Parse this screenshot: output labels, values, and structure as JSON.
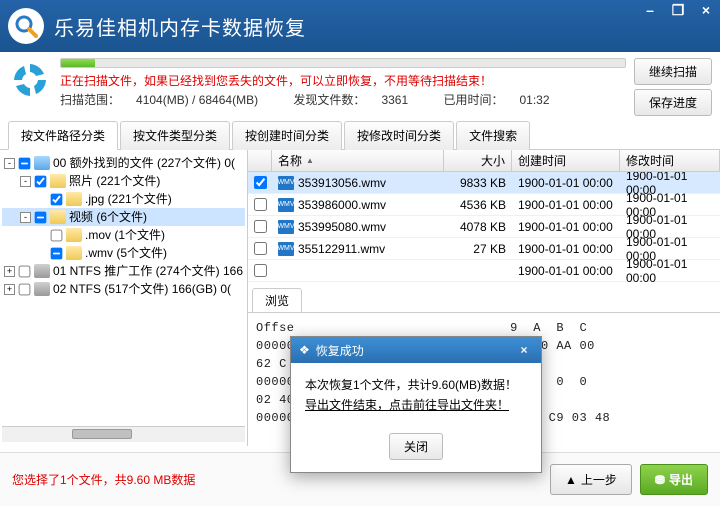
{
  "title": "乐易佳相机内存卡数据恢复",
  "window": {
    "min": "–",
    "max": "❐",
    "close": "×"
  },
  "status": {
    "message": "正在扫描文件，如果已经找到您丢失的文件，可以立即恢复，不用等待扫描结束！",
    "rangeLabel": "扫描范围：",
    "rangeValue": "4104(MB) / 68464(MB)",
    "foundLabel": "发现文件数：",
    "foundValue": "3361",
    "elapsedLabel": "已用时间：",
    "elapsedValue": "01:32",
    "btnContinue": "继续扫描",
    "btnSave": "保存进度"
  },
  "tabs": [
    "按文件路径分类",
    "按文件类型分类",
    "按创建时间分类",
    "按修改时间分类",
    "文件搜索"
  ],
  "tree": [
    {
      "depth": 0,
      "glyph": "-",
      "check": "mixed",
      "icon": "root",
      "label": "00 额外找到的文件  (227个文件) 0("
    },
    {
      "depth": 1,
      "glyph": "-",
      "check": true,
      "icon": "folder",
      "label": "照片  (221个文件)"
    },
    {
      "depth": 2,
      "glyph": "",
      "check": true,
      "icon": "folder",
      "label": ".jpg   (221个文件)"
    },
    {
      "depth": 1,
      "glyph": "-",
      "check": "mixed",
      "icon": "folder",
      "label": "视频  (6个文件)",
      "sel": true
    },
    {
      "depth": 2,
      "glyph": "",
      "check": false,
      "icon": "folder",
      "label": ".mov   (1个文件)"
    },
    {
      "depth": 2,
      "glyph": "",
      "check": "mixed",
      "icon": "folder",
      "label": ".wmv   (5个文件)"
    },
    {
      "depth": 0,
      "glyph": "+",
      "check": false,
      "icon": "drive",
      "label": "01 NTFS  推广工作  (274个文件) 166"
    },
    {
      "depth": 0,
      "glyph": "+",
      "check": false,
      "icon": "drive",
      "label": "02 NTFS     (517个文件) 166(GB) 0("
    }
  ],
  "gridHeaders": {
    "name": "名称",
    "size": "大小",
    "ctime": "创建时间",
    "mtime": "修改时间"
  },
  "gridRows": [
    {
      "check": true,
      "name": "353913056.wmv",
      "size": "9833 KB",
      "ctime": "1900-01-01  00:00",
      "mtime": "1900-01-01  00:00",
      "sel": true
    },
    {
      "check": false,
      "name": "353986000.wmv",
      "size": "4536 KB",
      "ctime": "1900-01-01  00:00",
      "mtime": "1900-01-01  00:00"
    },
    {
      "check": false,
      "name": "353995080.wmv",
      "size": "4078 KB",
      "ctime": "1900-01-01  00:00",
      "mtime": "1900-01-01  00:00"
    },
    {
      "check": false,
      "name": "355122911.wmv",
      "size": "27 KB",
      "ctime": "1900-01-01  00:00",
      "mtime": "1900-01-01  00:00"
    },
    {
      "check": false,
      "name": "",
      "size": "",
      "ctime": "1900-01-01  00:00",
      "mtime": "1900-01-01  00:00"
    }
  ],
  "previewTab": "浏览",
  "hex": "Offse                            9  A  B  C\n00000                            D9 00 AA 00\n62 C\n00000 0  0  0  0  0  0  0  0  0  0  0  0  0 \n02 40 50    Y...........@R\n00000052 D1 86 D1 10 A3 D  31   00 A0 C9 03 48",
  "dialog": {
    "title": "恢复成功",
    "line1": "本次恢复1个文件，共计9.60(MB)数据！",
    "line2": "导出文件结束，点击前往导出文件夹！",
    "close": "关闭"
  },
  "footer": {
    "selection": "您选择了1个文件，共9.60 MB数据",
    "prev": "上一步",
    "export": "导出"
  }
}
